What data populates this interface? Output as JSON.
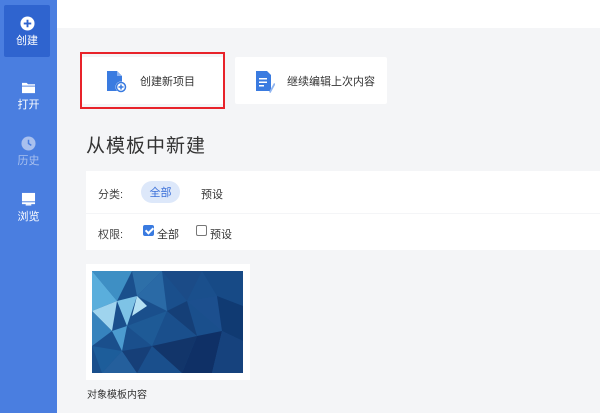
{
  "sidebar": {
    "items": [
      {
        "label": "创建",
        "icon": "plus-circle-icon",
        "state": "active"
      },
      {
        "label": "打开",
        "icon": "folder-icon",
        "state": "normal"
      },
      {
        "label": "历史",
        "icon": "clock-icon",
        "state": "disabled"
      },
      {
        "label": "浏览",
        "icon": "monitor-icon",
        "state": "normal"
      }
    ]
  },
  "actions": {
    "new_project": {
      "label": "创建新项目",
      "icon": "new-file-icon"
    },
    "continue_edit": {
      "label": "继续编辑上次内容",
      "icon": "document-edit-icon"
    }
  },
  "section_title": "从模板中新建",
  "filters": {
    "category": {
      "label": "分类:",
      "options": [
        "全部",
        "预设"
      ],
      "selected": "全部"
    },
    "permission": {
      "label": "权限:",
      "options": [
        {
          "label": "全部",
          "checked": true
        },
        {
          "label": "预设",
          "checked": false
        }
      ]
    }
  },
  "templates": [
    {
      "caption": "对象模板内容"
    }
  ],
  "colors": {
    "sidebar_bg": "#4a7ee0",
    "sidebar_active": "#2f64cf",
    "accent": "#3a7be0",
    "highlight_border": "#e8232a",
    "page_bg": "#f4f5f7"
  }
}
